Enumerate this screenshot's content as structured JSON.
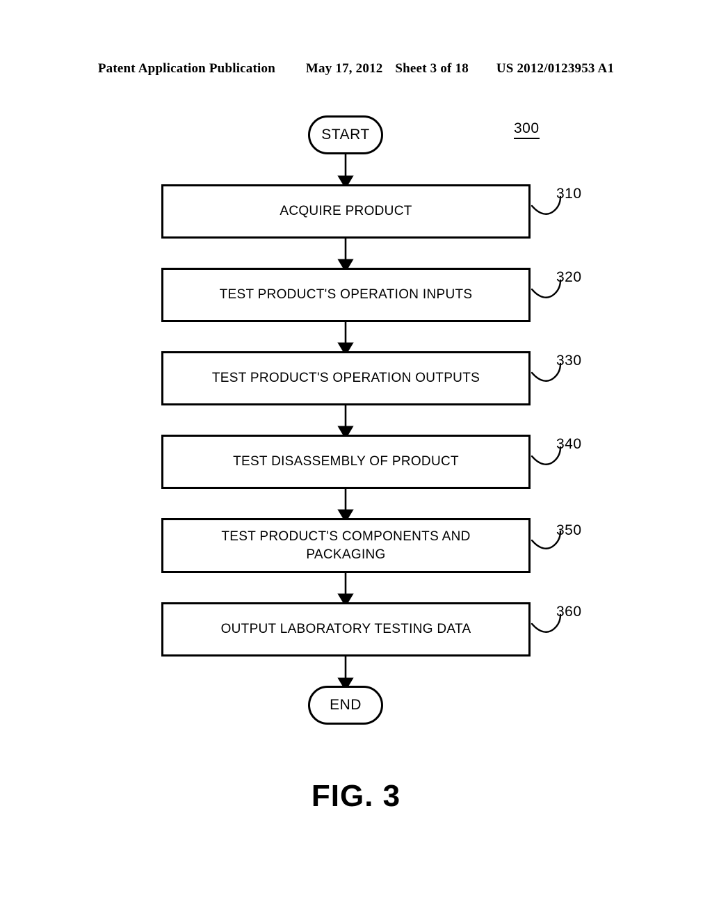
{
  "header": {
    "publication_label": "Patent Application Publication",
    "date": "May 17, 2012",
    "sheet": "Sheet 3 of 18",
    "publication_number": "US 2012/0123953 A1"
  },
  "figure": {
    "caption": "FIG. 3",
    "diagram_reference": "300"
  },
  "flowchart": {
    "type": "flowchart",
    "orientation": "top-to-bottom",
    "start_node": {
      "label": "START",
      "shape": "terminator"
    },
    "end_node": {
      "label": "END",
      "shape": "terminator"
    },
    "steps": [
      {
        "ref": "310",
        "lines": [
          "ACQUIRE PRODUCT"
        ]
      },
      {
        "ref": "320",
        "lines": [
          "TEST PRODUCT'S OPERATION INPUTS"
        ]
      },
      {
        "ref": "330",
        "lines": [
          "TEST PRODUCT'S OPERATION OUTPUTS"
        ]
      },
      {
        "ref": "340",
        "lines": [
          "TEST DISASSEMBLY OF PRODUCT"
        ]
      },
      {
        "ref": "350",
        "lines": [
          "TEST PRODUCT'S COMPONENTS AND",
          "PACKAGING"
        ]
      },
      {
        "ref": "360",
        "lines": [
          "OUTPUT LABORATORY TESTING DATA"
        ]
      }
    ]
  },
  "colors": {
    "ink": "#000000",
    "page": "#ffffff"
  }
}
